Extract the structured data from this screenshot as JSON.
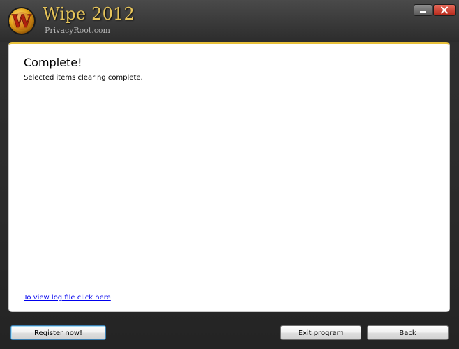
{
  "app": {
    "title": "Wipe 2012",
    "subtitle": "PrivacyRoot.com",
    "logo_letter": "W"
  },
  "window_controls": {
    "minimize_icon": "minimize-icon",
    "close_icon": "close-icon"
  },
  "main": {
    "heading": "Complete!",
    "message": "Selected items clearing complete.",
    "log_link": "To view log file click here"
  },
  "buttons": {
    "register": "Register now!",
    "exit": "Exit program",
    "back": "Back"
  },
  "colors": {
    "title_gold": "#e6c45a",
    "panel_accent": "#e7c03a",
    "link": "#0000ee",
    "close_red": "#c8392b"
  }
}
